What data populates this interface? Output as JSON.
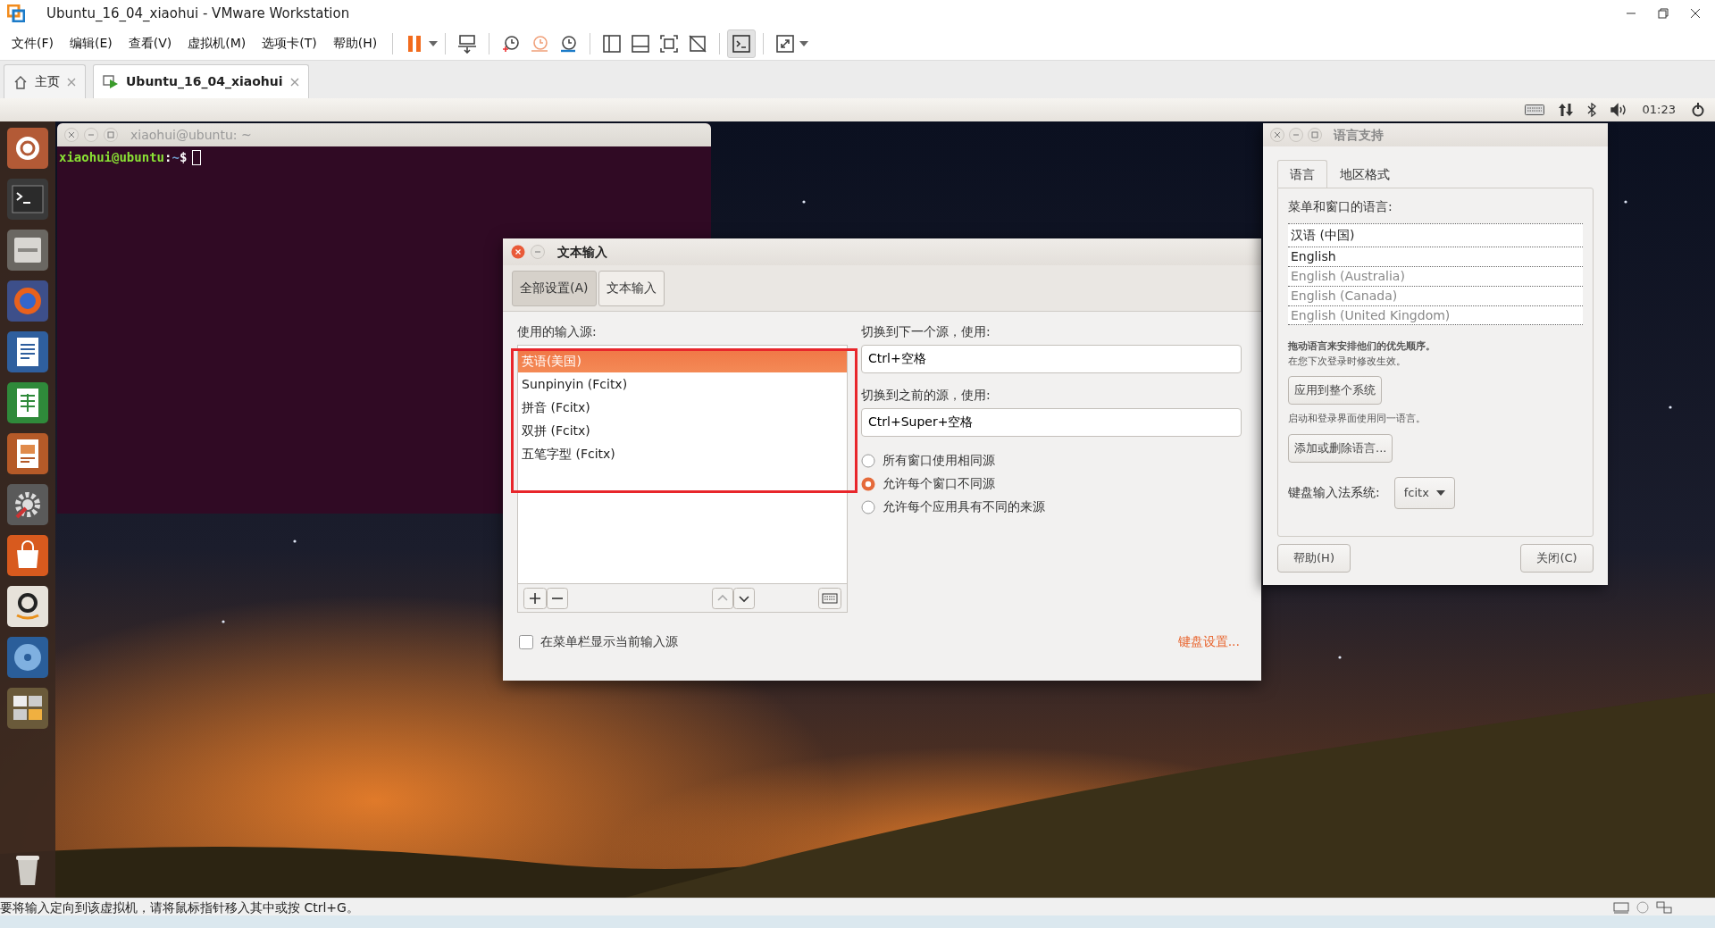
{
  "window": {
    "title": "Ubuntu_16_04_xiaohui - VMware Workstation"
  },
  "menu": [
    "文件(F)",
    "编辑(E)",
    "查看(V)",
    "虚拟机(M)",
    "选项卡(T)",
    "帮助(H)"
  ],
  "tabs": [
    {
      "label": "主页",
      "selected": false
    },
    {
      "label": "Ubuntu_16_04_xiaohui",
      "selected": true
    }
  ],
  "panel": {
    "clock": "01:23"
  },
  "terminal": {
    "title": "xiaohui@ubuntu: ~",
    "prompt": [
      {
        "text": "xiaohui@ubuntu",
        "color": "#8ae234"
      },
      {
        "text": ":",
        "color": "#ffffff"
      },
      {
        "text": "~",
        "color": "#729fcf"
      },
      {
        "text": "$",
        "color": "#ffffff"
      }
    ]
  },
  "text_input": {
    "title": "文本输入",
    "breadcrumbs": [
      {
        "label": "全部设置(A)",
        "selected": false
      },
      {
        "label": "文本输入",
        "selected": true
      }
    ],
    "sources_label": "使用的输入源:",
    "sources": [
      {
        "label": "英语(美国)",
        "selected": true
      },
      {
        "label": "Sunpinyin (Fcitx)",
        "selected": false
      },
      {
        "label": "拼音 (Fcitx)",
        "selected": false
      },
      {
        "label": "双拼 (Fcitx)",
        "selected": false
      },
      {
        "label": "五笔字型 (Fcitx)",
        "selected": false
      }
    ],
    "next_label": "切换到下一个源，使用:",
    "next_value": "Ctrl+空格",
    "prev_label": "切换到之前的源，使用:",
    "prev_value": "Ctrl+Super+空格",
    "modes": [
      {
        "label": "所有窗口使用相同源",
        "selected": false
      },
      {
        "label": "允许每个窗口不同源",
        "selected": true
      },
      {
        "label": "允许每个应用具有不同的来源",
        "selected": false
      }
    ],
    "show_indicator": {
      "label": "在菜单栏显示当前输入源",
      "checked": false
    },
    "keyboard_link": "键盘设置..."
  },
  "language_support": {
    "title": "语言支持",
    "tabs": [
      {
        "label": "语言",
        "selected": true
      },
      {
        "label": "地区格式",
        "selected": false
      }
    ],
    "list_label": "菜单和窗口的语言:",
    "languages": [
      {
        "label": "汉语 (中国)",
        "dimmed": false
      },
      {
        "label": "English",
        "dimmed": false
      },
      {
        "label": "English (Australia)",
        "dimmed": true
      },
      {
        "label": "English (Canada)",
        "dimmed": true
      },
      {
        "label": "English (United Kingdom)",
        "dimmed": true
      }
    ],
    "drag_hint": "拖动语言来安排他们的优先顺序。",
    "relogin_hint": "在您下次登录时修改生效。",
    "apply_button": "应用到整个系统",
    "boot_hint": "启动和登录界面使用同一语言。",
    "add_button": "添加或删除语言...",
    "im_label": "键盘输入法系统:",
    "im_value": "fcitx",
    "help_button": "帮助(H)",
    "close_button": "关闭(C)"
  },
  "status_bar": {
    "text": "要将输入定向到该虚拟机，请将鼠标指针移入其中或按 Ctrl+G。"
  }
}
